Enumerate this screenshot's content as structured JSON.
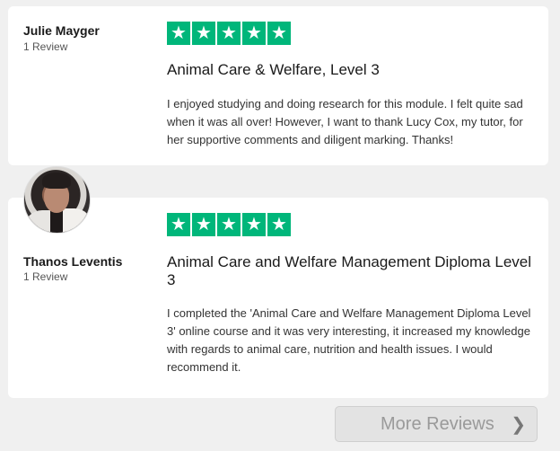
{
  "reviews": [
    {
      "name": "Julie Mayger",
      "review_count": "1 Review",
      "rating": 5,
      "title": "Animal Care & Welfare, Level 3",
      "body": "I enjoyed studying and doing research for this module. I felt quite sad when it was all over! However, I want to thank Lucy Cox, my tutor, for her supportive comments and diligent marking. Thanks!"
    },
    {
      "name": "Thanos Leventis",
      "review_count": "1 Review",
      "rating": 5,
      "title": "Animal Care and Welfare Management Diploma Level 3",
      "body": "I completed the 'Animal Care and Welfare Management Diploma Level 3' online course and it was very interesting, it increased my knowledge with regards to animal care, nutrition and health issues. I would recommend it."
    }
  ],
  "more_reviews": {
    "label": "More Reviews"
  },
  "colors": {
    "star_green": "#00b67a",
    "card_bg": "#ffffff",
    "page_bg": "#f0f0f0"
  },
  "icons": {
    "star": "star-icon",
    "chevron": "chevron-right-icon"
  }
}
